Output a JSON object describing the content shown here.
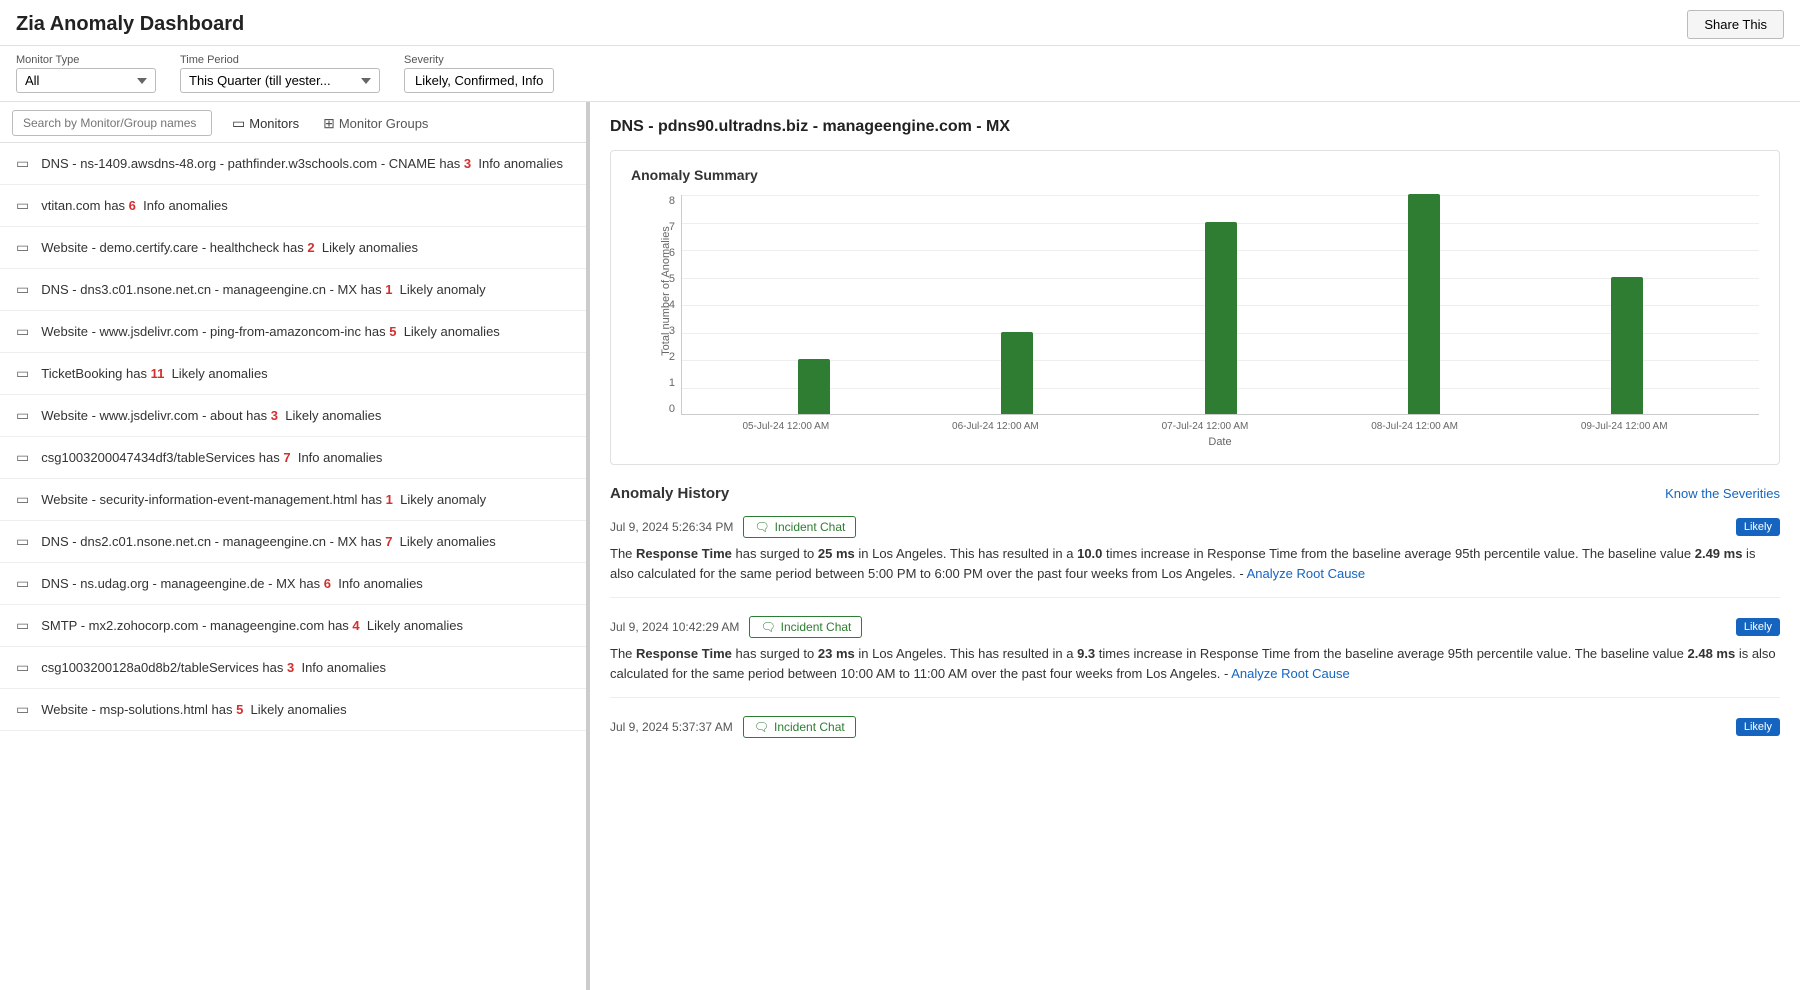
{
  "page": {
    "title": "Zia Anomaly Dashboard",
    "share_btn": "Share This"
  },
  "filters": {
    "monitor_type_label": "Monitor Type",
    "monitor_type_value": "All",
    "time_period_label": "Time Period",
    "time_period_value": "This Quarter (till yester...",
    "severity_label": "Severity",
    "severity_value": "Likely, Confirmed, Info"
  },
  "search": {
    "placeholder": "Search by Monitor/Group names"
  },
  "tabs": {
    "monitors": "Monitors",
    "monitor_groups": "Monitor Groups"
  },
  "list_items": [
    {
      "text": "DNS - ns-1409.awsdns-48.org - pathfinder.w3schools.com - CNAME has",
      "count": "3",
      "count_type": "red",
      "suffix": "Info anomalies"
    },
    {
      "text": "vtitan.com has",
      "count": "6",
      "count_type": "red",
      "suffix": "Info anomalies"
    },
    {
      "text": "Website - demo.certify.care - healthcheck has",
      "count": "2",
      "count_type": "red",
      "suffix": "Likely anomalies"
    },
    {
      "text": "DNS - dns3.c01.nsone.net.cn - manageengine.cn - MX has",
      "count": "1",
      "count_type": "red",
      "suffix": "Likely anomaly"
    },
    {
      "text": "Website - www.jsdelivr.com - ping-from-amazoncom-inc has",
      "count": "5",
      "count_type": "red",
      "suffix": "Likely anomalies"
    },
    {
      "text": "TicketBooking has",
      "count": "11",
      "count_type": "red",
      "suffix": "Likely anomalies"
    },
    {
      "text": "Website - www.jsdelivr.com - about has",
      "count": "3",
      "count_type": "red",
      "suffix": "Likely anomalies"
    },
    {
      "text": "csg1003200047434df3/tableServices has",
      "count": "7",
      "count_type": "red",
      "suffix": "Info anomalies"
    },
    {
      "text": "Website - security-information-event-management.html has",
      "count": "1",
      "count_type": "red",
      "suffix": "Likely anomaly"
    },
    {
      "text": "DNS - dns2.c01.nsone.net.cn - manageengine.cn - MX has",
      "count": "7",
      "count_type": "red",
      "suffix": "Likely anomalies"
    },
    {
      "text": "DNS - ns.udag.org - manageengine.de - MX has",
      "count": "6",
      "count_type": "red",
      "suffix": "Info anomalies"
    },
    {
      "text": "SMTP - mx2.zohocorp.com - manageengine.com has",
      "count": "4",
      "count_type": "red",
      "suffix": "Likely anomalies"
    },
    {
      "text": "csg1003200128a0d8b2/tableServices has",
      "count": "3",
      "count_type": "red",
      "suffix": "Info anomalies"
    },
    {
      "text": "Website - msp-solutions.html has",
      "count": "5",
      "count_type": "red",
      "suffix": "Likely anomalies"
    }
  ],
  "detail": {
    "title": "DNS - pdns90.ultradns.biz - manageengine.com - MX",
    "chart": {
      "title": "Anomaly Summary",
      "y_axis_title": "Total number of Anomalies",
      "x_axis_title": "Date",
      "y_labels": [
        "8",
        "7",
        "6",
        "5",
        "4",
        "3",
        "2",
        "1",
        "0"
      ],
      "bars": [
        {
          "date": "05-Jul-24 12:00 AM",
          "value": 2
        },
        {
          "date": "06-Jul-24 12:00 AM",
          "value": 3
        },
        {
          "date": "07-Jul-24 12:00 AM",
          "value": 7
        },
        {
          "date": "08-Jul-24 12:00 AM",
          "value": 8
        },
        {
          "date": "09-Jul-24 12:00 AM",
          "value": 5
        }
      ],
      "max_value": 8
    },
    "history": {
      "title": "Anomaly History",
      "know_severities": "Know the Severities",
      "entries": [
        {
          "timestamp": "Jul 9, 2024 5:26:34 PM",
          "incident_chat": "Incident Chat",
          "badge": "Likely",
          "text_pre": "The ",
          "text_bold1": "Response Time",
          "text_mid1": " has surged to ",
          "text_bold2": "25 ms",
          "text_mid2": " in Los Angeles. This has resulted in a ",
          "text_bold3": "10.0",
          "text_mid3": " times increase in Response Time from the baseline average 95th percentile value. The baseline value ",
          "text_bold4": "2.49 ms",
          "text_mid4": " is also calculated for the same period between 5:00 PM to 6:00 PM over the past four weeks from Los Angeles. - ",
          "analyze_link": "Analyze Root Cause"
        },
        {
          "timestamp": "Jul 9, 2024 10:42:29 AM",
          "incident_chat": "Incident Chat",
          "badge": "Likely",
          "text_pre": "The ",
          "text_bold1": "Response Time",
          "text_mid1": " has surged to ",
          "text_bold2": "23 ms",
          "text_mid2": " in Los Angeles. This has resulted in a ",
          "text_bold3": "9.3",
          "text_mid3": " times increase in Response Time from the baseline average 95th percentile value. The baseline value ",
          "text_bold4": "2.48 ms",
          "text_mid4": " is also calculated for the same period between 10:00 AM to 11:00 AM over the past four weeks from Los Angeles. - ",
          "analyze_link": "Analyze Root Cause"
        },
        {
          "timestamp": "Jul 9, 2024 5:37:37 AM",
          "incident_chat": "Incident Chat",
          "badge": "Likely",
          "text_pre": "",
          "text_bold1": "",
          "text_mid1": "",
          "text_bold2": "",
          "text_mid2": "",
          "text_bold3": "",
          "text_mid3": "",
          "text_bold4": "",
          "text_mid4": "",
          "analyze_link": ""
        }
      ]
    }
  }
}
